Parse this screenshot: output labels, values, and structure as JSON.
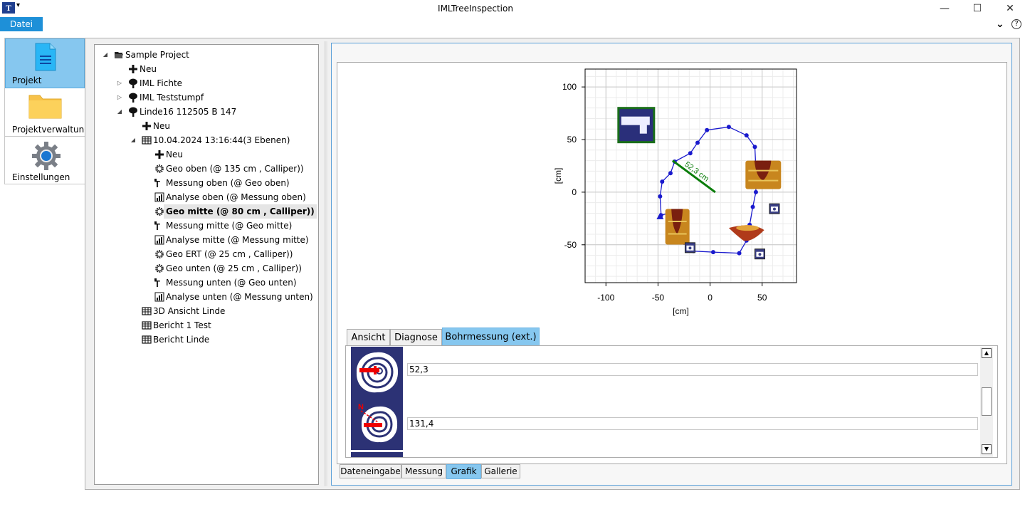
{
  "window": {
    "title": "IMLTreeInspection",
    "icon_letter": "T",
    "minimize": "—",
    "maximize": "☐",
    "close": "✕"
  },
  "menu": {
    "datei": "Datei",
    "help": "?"
  },
  "nav": {
    "projekt": "Projekt",
    "projektverwaltung": "Projektverwaltung",
    "einstellungen": "Einstellungen"
  },
  "tree": [
    {
      "text": "Sample Project",
      "level": 0,
      "exp": "◢",
      "icon": "folder-open-icon"
    },
    {
      "text": "Neu",
      "level": 1,
      "exp": "",
      "icon": "plus-icon"
    },
    {
      "text": "IML Fichte",
      "level": 1,
      "exp": "▷",
      "icon": "tree-icon"
    },
    {
      "text": "IML Teststumpf",
      "level": 1,
      "exp": "▷",
      "icon": "tree-icon"
    },
    {
      "text": "Linde16 112505 B 147",
      "level": 1,
      "exp": "◢",
      "icon": "tree-icon"
    },
    {
      "text": "Neu",
      "level": 2,
      "exp": "",
      "icon": "plus-icon"
    },
    {
      "text": "10.04.2024 13:16:44(3 Ebenen)",
      "level": 2,
      "exp": "◢",
      "icon": "grid-icon"
    },
    {
      "text": "Neu",
      "level": 3,
      "exp": "",
      "icon": "plus-icon"
    },
    {
      "text": "Geo oben (@ 135 cm , Calliper))",
      "level": 3,
      "exp": "",
      "icon": "gear-outline-icon"
    },
    {
      "text": "Messung oben (@ Geo oben)",
      "level": 3,
      "exp": "",
      "icon": "measure-icon"
    },
    {
      "text": "Analyse oben (@ Messung oben)",
      "level": 3,
      "exp": "",
      "icon": "bar-chart-icon"
    },
    {
      "text": "Geo mitte (@ 80 cm , Calliper))",
      "level": 3,
      "exp": "",
      "icon": "gear-outline-icon",
      "selected": true
    },
    {
      "text": "Messung mitte (@ Geo mitte)",
      "level": 3,
      "exp": "",
      "icon": "measure-icon"
    },
    {
      "text": "Analyse mitte (@ Messung mitte)",
      "level": 3,
      "exp": "",
      "icon": "bar-chart-icon"
    },
    {
      "text": "Geo ERT (@ 25 cm , Calliper))",
      "level": 3,
      "exp": "",
      "icon": "gear-outline-icon"
    },
    {
      "text": "Geo unten (@ 25 cm , Calliper))",
      "level": 3,
      "exp": "",
      "icon": "gear-outline-icon"
    },
    {
      "text": "Messung unten (@ Geo unten)",
      "level": 3,
      "exp": "",
      "icon": "measure-icon"
    },
    {
      "text": "Analyse unten (@ Messung unten)",
      "level": 3,
      "exp": "",
      "icon": "bar-chart-icon"
    },
    {
      "text": "3D Ansicht Linde",
      "level": 2,
      "exp": "",
      "icon": "grid-icon"
    },
    {
      "text": "Bericht 1 Test",
      "level": 2,
      "exp": "",
      "icon": "grid-icon"
    },
    {
      "text": "Bericht Linde",
      "level": 2,
      "exp": "",
      "icon": "grid-icon"
    }
  ],
  "chart_data": {
    "type": "scatter",
    "xlabel": "[cm]",
    "ylabel": "[cm]",
    "xlim": [
      -120,
      83
    ],
    "ylim": [
      -86,
      117
    ],
    "xticks": [
      -100,
      -50,
      0,
      50
    ],
    "yticks": [
      100,
      50,
      0,
      -50
    ],
    "grid": true,
    "outline_points": [
      [
        -47,
        -22
      ],
      [
        -48,
        -4
      ],
      [
        -46,
        10
      ],
      [
        -38,
        18
      ],
      [
        -34,
        29
      ],
      [
        -19,
        37
      ],
      [
        -12,
        47
      ],
      [
        -3,
        59
      ],
      [
        18,
        62
      ],
      [
        35,
        54
      ],
      [
        43,
        43
      ],
      [
        44,
        22
      ],
      [
        44,
        0
      ],
      [
        41,
        -14
      ],
      [
        38,
        -31
      ],
      [
        35,
        -46
      ],
      [
        28,
        -58
      ],
      [
        3,
        -57
      ],
      [
        -16,
        -56
      ],
      [
        -25,
        -48
      ],
      [
        -28,
        -40
      ],
      [
        -32,
        -20
      ],
      [
        -40,
        -20
      ]
    ],
    "start_marker": [
      -48,
      -23
    ],
    "measure_line": {
      "from": [
        -36,
        30
      ],
      "to": [
        5,
        0
      ],
      "label": "52,3 cm"
    },
    "colors": {
      "outline": "#1a1acd",
      "measure": "#0a7d0a",
      "photo_frame": "#1a6e1a"
    }
  },
  "tabs": {
    "ansicht": "Ansicht",
    "diagnose": "Diagnose",
    "bohrmessung": "Bohrmessung (ext.)"
  },
  "measurements": [
    {
      "value": "52,3",
      "icon": "drill-measure-icon"
    },
    {
      "value": "131,4",
      "icon": "drill-north-icon",
      "north": "N"
    }
  ],
  "bottom_tabs": {
    "dateneingabe": "Dateneingabe",
    "messung": "Messung",
    "grafik": "Grafik",
    "gallerie": "Gallerie"
  }
}
